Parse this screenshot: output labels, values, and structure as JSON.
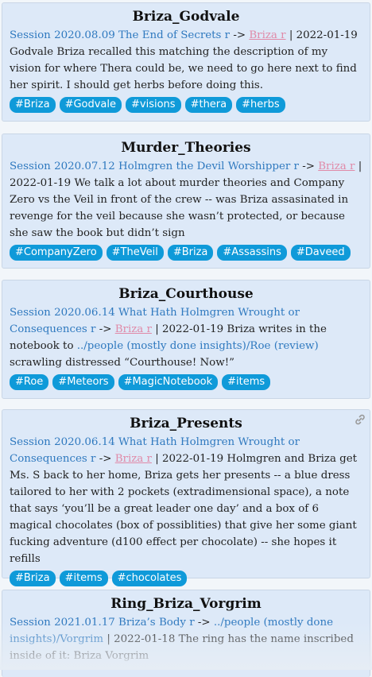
{
  "cards": [
    {
      "title": "Briza_Godvale",
      "session": "Session 2020.08.09 The End of Secrets r",
      "arrow": " -> ",
      "target": "Briza r",
      "pipe_date": " | 2022-01-19",
      "text": " Godvale Briza recalled this matching the description of my vision for where Thera could be, we need to go here next to find her spirit. I should get herbs before doing this.",
      "tags": [
        "#Briza",
        "#Godvale",
        "#visions",
        "#thera",
        "#herbs"
      ]
    },
    {
      "title": "Murder_Theories",
      "session": "Session 2020.07.12 Holmgren the Devil Worshipper r",
      "arrow": " -> ",
      "target": "Briza r",
      "pipe_date": " | 2022-01-19",
      "text": " We talk a lot about murder theories and Company Zero vs the Veil in front of the crew -- was Briza assasinated in revenge for the veil because she wasn’t protected, or because she saw the book but didn’t sign",
      "tags": [
        "#CompanyZero",
        "#TheVeil",
        "#Briza",
        "#Assassins",
        "#Daveed"
      ]
    },
    {
      "title": "Briza_Courthouse",
      "session": "Session 2020.06.14 What Hath Holmgren Wrought or Consequences r",
      "arrow": " -> ",
      "target": "Briza r",
      "pipe_date": " | 2022-01-19",
      "text_before": " Briza writes in the notebook to ",
      "inline_link": "../people (mostly done insights)/Roe (review)",
      "text_after": " scrawling distressed “Courthouse! Now!”",
      "tags": [
        "#Roe",
        "#Meteors",
        "#MagicNotebook",
        "#items"
      ]
    },
    {
      "title": "Briza_Presents",
      "session": "Session 2020.06.14 What Hath Holmgren Wrought or Consequences r",
      "arrow": " -> ",
      "target": "Briza r",
      "pipe_date": " | 2022-01-19",
      "text": " Holmgren and Briza get Ms. S back to her home, Briza gets her presents -- a blue dress tailored to her with 2 pockets (extradimensional space), a note that says ‘you’ll be a great leader one day’ and a box of 6 magical chocolates (box of possiblities) that give her some giant fucking adventure (d100 effect per chocolate) -- she hopes it refills",
      "tags": [
        "#Briza",
        "#items",
        "#chocolates"
      ],
      "icon": "link-icon"
    },
    {
      "title": "Ring_Briza_Vorgrim",
      "session": "Session 2021.01.17 Briza’s Body r",
      "arrow": " -> ",
      "target": "../people (mostly done insights)/Vorgrim",
      "pipe_date": " | 2022-01-18",
      "text": " The ring has the name inscribed inside of it: Briza Vorgrim",
      "tags": []
    }
  ]
}
